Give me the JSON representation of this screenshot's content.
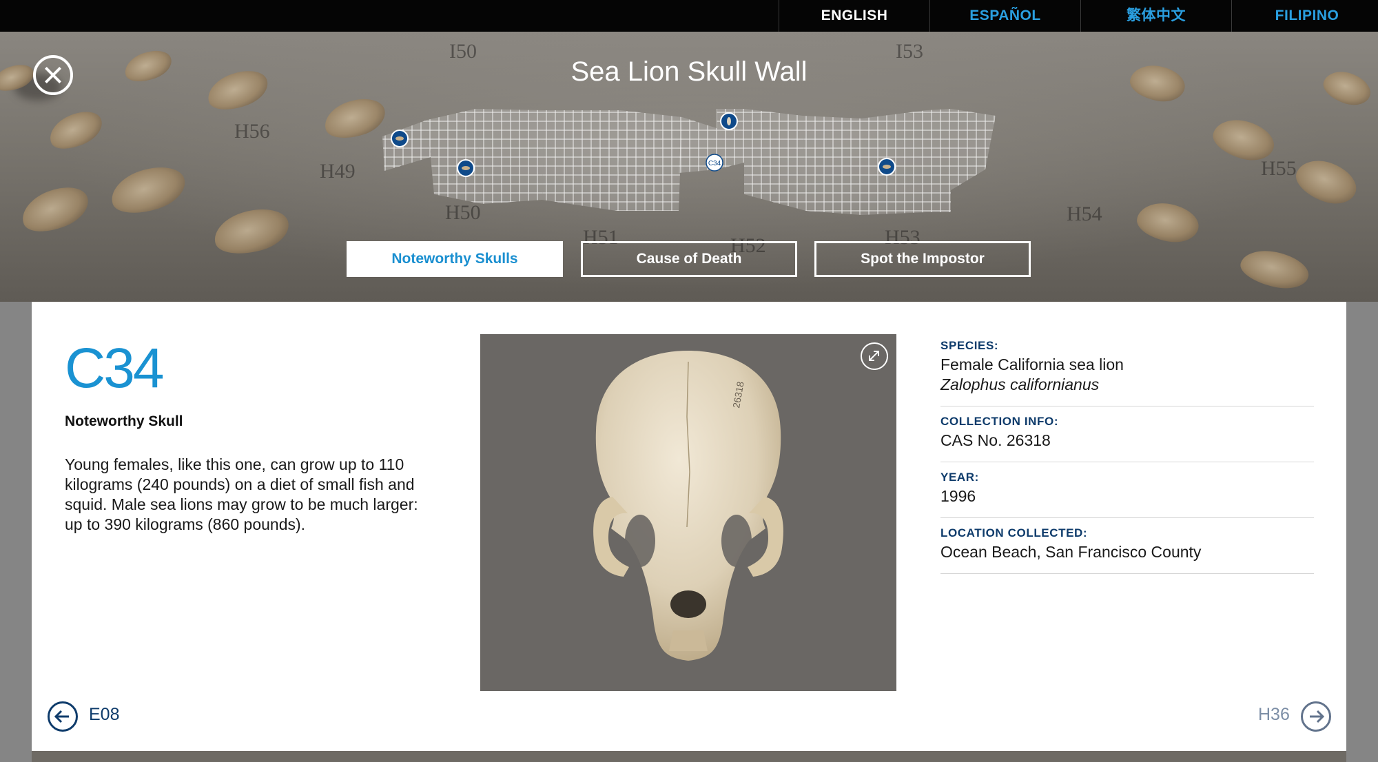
{
  "languages": [
    {
      "label": "ENGLISH",
      "active": true
    },
    {
      "label": "ESPAÑOL",
      "active": false
    },
    {
      "label": "繁体中文",
      "active": false
    },
    {
      "label": "FILIPINO",
      "active": false
    }
  ],
  "hero": {
    "title": "Sea Lion Skull Wall",
    "wall_numbers": [
      "I50",
      "I53",
      "H49",
      "H50",
      "H51",
      "H55",
      "H54",
      "H56",
      "H52",
      "H53"
    ],
    "current_marker": "C34"
  },
  "tabs": [
    {
      "label": "Noteworthy Skulls",
      "active": true
    },
    {
      "label": "Cause of Death",
      "active": false
    },
    {
      "label": "Spot the Impostor",
      "active": false
    }
  ],
  "detail": {
    "id": "C34",
    "subtitle": "Noteworthy Skull",
    "description": "Young females, like this one, can grow up to 110 kilograms (240 pounds) on a diet of small fish and squid. Male sea lions may grow to be much larger: up to 390 kilograms (860 pounds).",
    "skull_specimen_mark": "26318"
  },
  "info": {
    "species_label": "SPECIES:",
    "species_common": "Female California sea lion",
    "species_latin": "Zalophus californianus",
    "collection_label": "COLLECTION INFO:",
    "collection_value": "CAS No. 26318",
    "year_label": "YEAR:",
    "year_value": "1996",
    "location_label": "LOCATION COLLECTED:",
    "location_value": "Ocean Beach, San Francisco County"
  },
  "navigation": {
    "prev_label": "E08",
    "next_label": "H36"
  },
  "colors": {
    "accent_blue": "#1a92d2",
    "navy": "#0e3b6b",
    "marker_blue": "#0f4a8a"
  }
}
